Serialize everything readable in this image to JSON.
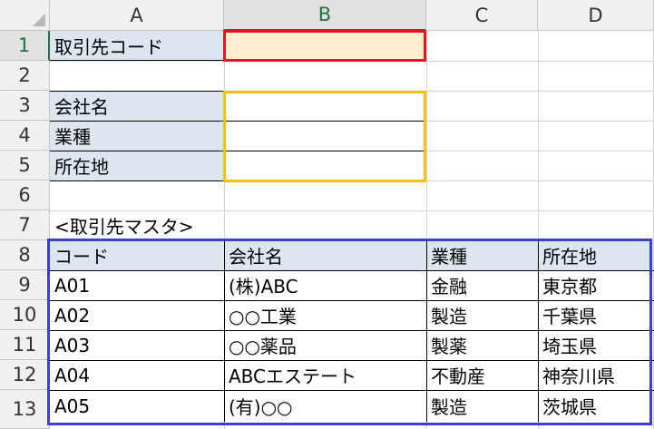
{
  "columns": [
    "A",
    "B",
    "C",
    "D"
  ],
  "rows": [
    "1",
    "2",
    "3",
    "4",
    "5",
    "6",
    "7",
    "8",
    "9",
    "10",
    "11",
    "12",
    "13"
  ],
  "active_cell": "B1",
  "lookup": {
    "code_label": "取引先コード",
    "code_value": "",
    "company_label": "会社名",
    "company_value": "",
    "industry_label": "業種",
    "industry_value": "",
    "location_label": "所在地",
    "location_value": ""
  },
  "master_title": "<取引先マスタ>",
  "master": {
    "headers": [
      "コード",
      "会社名",
      "業種",
      "所在地"
    ],
    "rows": [
      [
        "A01",
        "(株)ABC",
        "金融",
        "東京都"
      ],
      [
        "A02",
        "○○工業",
        "製造",
        "千葉県"
      ],
      [
        "A03",
        "○○薬品",
        "製薬",
        "埼玉県"
      ],
      [
        "A04",
        "ABCエステート",
        "不動産",
        "神奈川県"
      ],
      [
        "A05",
        "(有)○○",
        "製造",
        "茨城県"
      ]
    ]
  },
  "colors": {
    "label_fill": "#dce6f1",
    "input_fill": "#fdefcf",
    "red_box": "#e8141c",
    "orange_box": "#fbbf0e",
    "blue_box": "#3b3fd6",
    "active_header": "#217346"
  }
}
